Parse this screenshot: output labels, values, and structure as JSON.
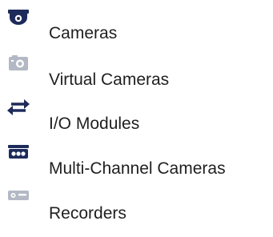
{
  "device_tree": {
    "items": [
      {
        "label": "Cameras",
        "icon": "camera-icon"
      },
      {
        "label": "Virtual Cameras",
        "icon": "virtual-camera-icon"
      },
      {
        "label": "I/O Modules",
        "icon": "io-module-icon"
      },
      {
        "label": "Multi-Channel Cameras",
        "icon": "multi-channel-camera-icon"
      },
      {
        "label": "Recorders",
        "icon": "recorder-icon"
      }
    ]
  },
  "colors": {
    "icon_active": "#1d2b5a",
    "icon_disabled": "#b3b9c4",
    "text": "#1f1f1f"
  }
}
